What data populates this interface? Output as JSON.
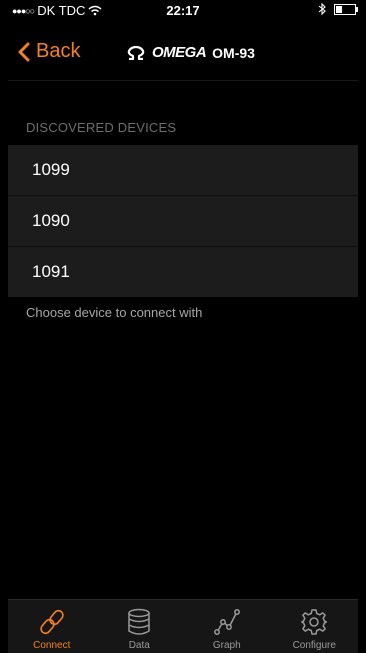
{
  "status_bar": {
    "carrier": "DK TDC",
    "time": "22:17"
  },
  "nav": {
    "back_label": "Back",
    "brand": "OMEGA",
    "model": "OM-93"
  },
  "devices": {
    "section_header": "DISCOVERED DEVICES",
    "items": [
      "1099",
      "1090",
      "1091"
    ],
    "footer_note": "Choose device to connect with"
  },
  "tabs": [
    {
      "label": "Connect",
      "icon": "link-icon",
      "active": true
    },
    {
      "label": "Data",
      "icon": "database-icon",
      "active": false
    },
    {
      "label": "Graph",
      "icon": "graph-icon",
      "active": false
    },
    {
      "label": "Configure",
      "icon": "gear-icon",
      "active": false
    }
  ],
  "colors": {
    "accent": "#f7821b",
    "background": "#000000",
    "row": "#1c1c1c",
    "tab_bar": "#161616"
  }
}
